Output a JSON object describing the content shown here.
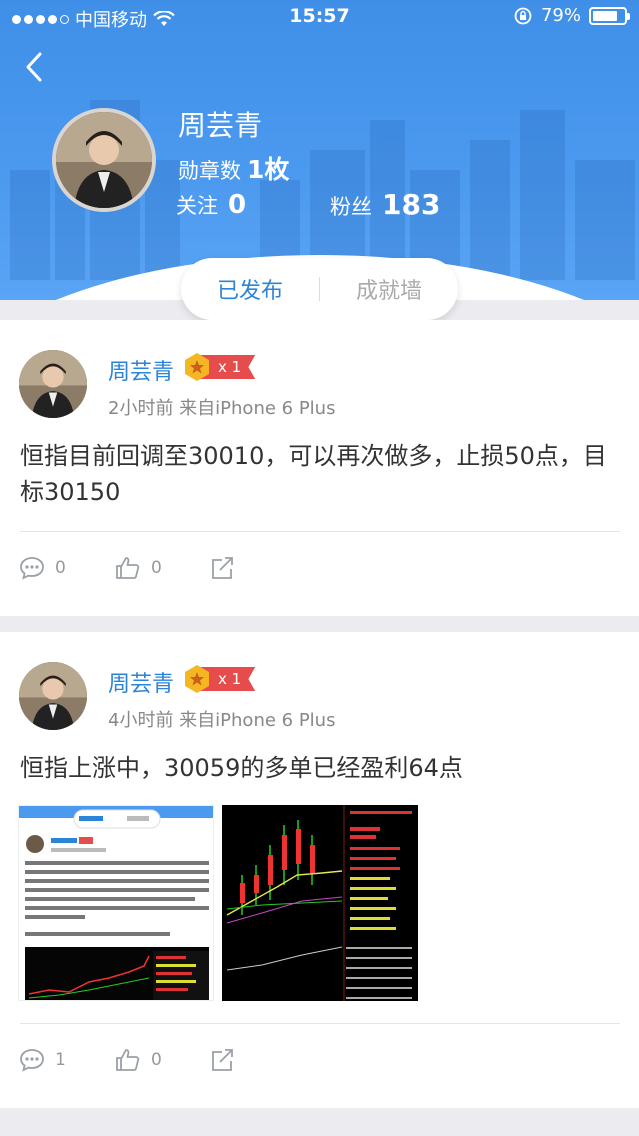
{
  "status_bar": {
    "carrier": "中国移动",
    "time": "15:57",
    "battery_percent": "79%",
    "battery_level": 0.79
  },
  "profile": {
    "name": "周芸青",
    "badges_label": "勋章数",
    "badges_value": "1枚",
    "follow_label": "关注",
    "follow_value": "0",
    "fans_label": "粉丝",
    "fans_value": "183"
  },
  "tabs": [
    {
      "label": "已发布",
      "active": true
    },
    {
      "label": "成就墙",
      "active": false
    }
  ],
  "posts": [
    {
      "author": "周芸青",
      "rank": "x 1",
      "meta": "2小时前  来自iPhone 6 Plus",
      "content": "恒指目前回调至30010，可以再次做多，止损50点，目标30150",
      "comments": "0",
      "likes": "0"
    },
    {
      "author": "周芸青",
      "rank": "x 1",
      "meta": "4小时前  来自iPhone 6 Plus",
      "content": "恒指上涨中，30059的多单已经盈利64点",
      "comments": "1",
      "likes": "0"
    }
  ],
  "colors": {
    "header": "#4c9af0",
    "accent": "#2a84d8",
    "rank_tag": "#e74c4c"
  }
}
